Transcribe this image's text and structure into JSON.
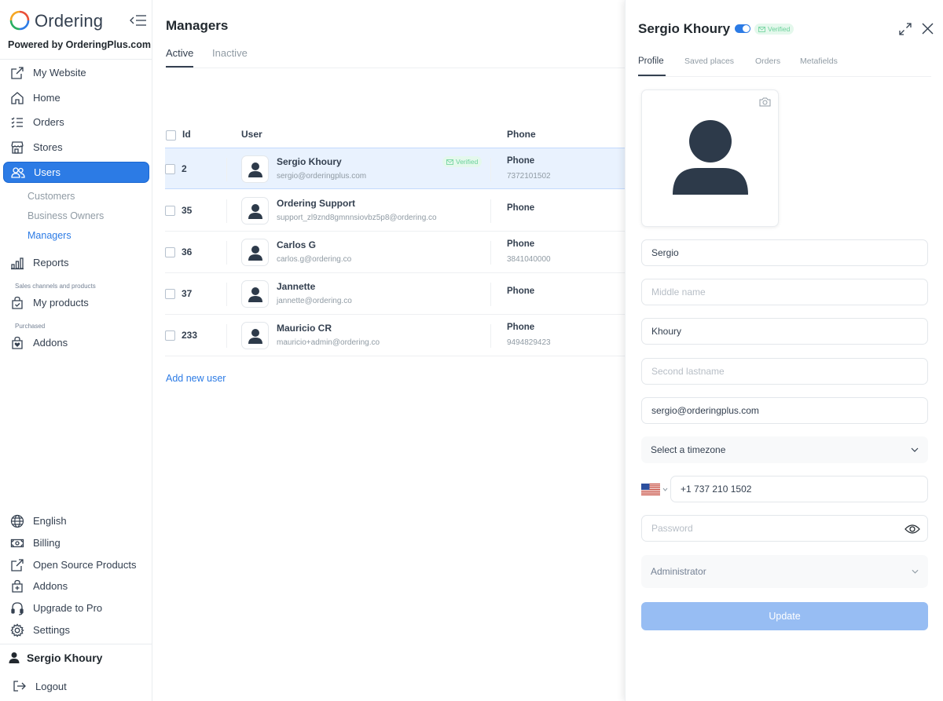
{
  "sidebar": {
    "brand_name": "Ordering",
    "powered_by": "Powered by OrderingPlus.com",
    "items": [
      {
        "label": "My Website",
        "icon": "external-link-icon"
      },
      {
        "label": "Home",
        "icon": "home-icon"
      },
      {
        "label": "Orders",
        "icon": "list-icon"
      },
      {
        "label": "Stores",
        "icon": "shop-icon"
      },
      {
        "label": "Users",
        "icon": "people-icon",
        "active": true
      },
      {
        "label": "Reports",
        "icon": "bar-chart-icon"
      },
      {
        "label": "My products",
        "icon": "bag-check-icon"
      },
      {
        "label": "Addons",
        "icon": "bag-heart-icon"
      }
    ],
    "users_sub": [
      "Customers",
      "Business Owners",
      "Managers"
    ],
    "active_sub": "Managers",
    "section_sales": "Sales channels and products",
    "section_purchased": "Purchased",
    "bottom_items": [
      {
        "label": "English",
        "icon": "globe-icon"
      },
      {
        "label": "Billing",
        "icon": "cash-icon"
      },
      {
        "label": "Open Source Products",
        "icon": "external-link-icon"
      },
      {
        "label": "Addons",
        "icon": "bag-plus-icon"
      },
      {
        "label": "Upgrade to Pro",
        "icon": "headset-icon"
      },
      {
        "label": "Settings",
        "icon": "gear-icon"
      }
    ],
    "user_name": "Sergio Khoury",
    "logout": "Logout"
  },
  "main": {
    "title": "Managers",
    "tabs": [
      "Active",
      "Inactive"
    ],
    "active_tab": "Active",
    "columns": {
      "id": "Id",
      "user": "User",
      "phone": "Phone"
    },
    "rows": [
      {
        "id": "2",
        "name": "Sergio Khoury",
        "email": "sergio@orderingplus.com",
        "phone_label": "Phone",
        "phone": "7372101502",
        "verified": "Verified",
        "selected": true
      },
      {
        "id": "35",
        "name": "Ordering Support",
        "email": "support_zl9znd8gmnnsiovbz5p8@ordering.co",
        "phone_label": "Phone",
        "phone": ""
      },
      {
        "id": "36",
        "name": "Carlos G",
        "email": "carlos.g@ordering.co",
        "phone_label": "Phone",
        "phone": "3841040000"
      },
      {
        "id": "37",
        "name": "Jannette",
        "email": "jannette@ordering.co",
        "phone_label": "Phone",
        "phone": ""
      },
      {
        "id": "233",
        "name": "Mauricio CR",
        "email": "mauricio+admin@ordering.co",
        "phone_label": "Phone",
        "phone": "9494829423"
      }
    ],
    "add_user": "Add new user"
  },
  "drawer": {
    "title": "Sergio Khoury",
    "verified": "Verified",
    "active_toggle": true,
    "tabs": [
      "Profile",
      "Saved places",
      "Orders",
      "Metafields"
    ],
    "active_tab": "Profile",
    "fields": {
      "first_name": "Sergio",
      "middle_name_placeholder": "Middle name",
      "lastname": "Khoury",
      "second_lastname_placeholder": "Second lastname",
      "email": "sergio@orderingplus.com",
      "timezone": "Select a timezone",
      "phone": "+1 737 210 1502",
      "password_placeholder": "Password",
      "role": "Administrator"
    },
    "update_button": "Update"
  },
  "colors": {
    "accent": "#2c7be5",
    "accent_disabled": "#97bdf3",
    "verified_bg": "#e4f8ec",
    "verified_text": "#6ad19a",
    "selected_row_bg": "#e9f2fe"
  }
}
